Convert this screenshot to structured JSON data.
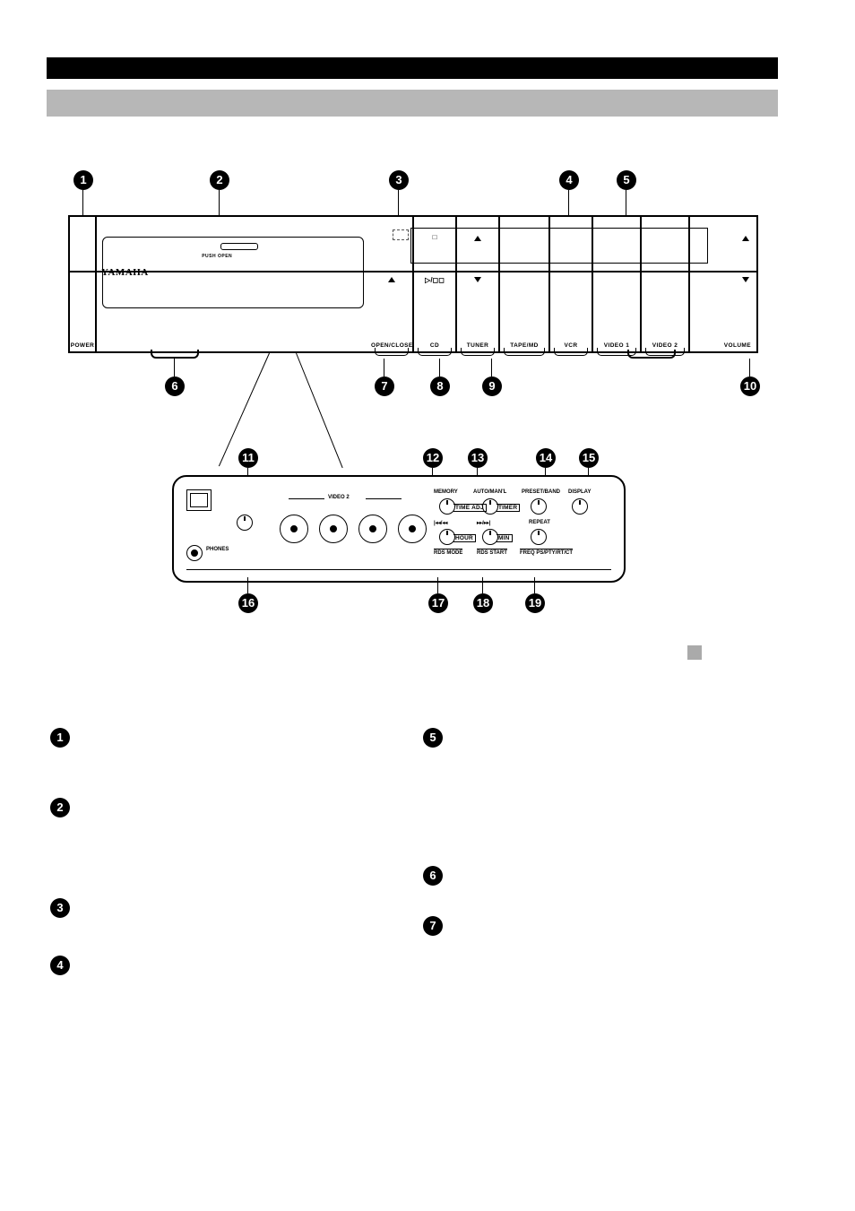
{
  "device": {
    "brand": "YAMAHA",
    "tray_sub": "PUSH OPEN",
    "buttons": {
      "power": "POWER",
      "open_close": "OPEN/CLOSE",
      "play_pause_label": "CD",
      "play_pause_glyph": "▷/◻◻",
      "stop_glyph": "□",
      "tuner": "TUNER",
      "tape_md": "TAPE/MD",
      "vcr": "VCR",
      "video1": "VIDEO 1",
      "video2": "VIDEO 2",
      "volume": "VOLUME"
    }
  },
  "detail": {
    "video2_label": "VIDEO 2",
    "phones_label": "PHONES",
    "row1": {
      "memory": "MEMORY",
      "time_adj": "TIME ADJ",
      "auto_manl": "AUTO/MAN'L",
      "timer": "TIMER",
      "preset_band": "PRESET/BAND",
      "display": "DISPLAY"
    },
    "row2": {
      "skip_back": "|◂◂/◂◂",
      "skip_fwd": "▸▸/▸▸|",
      "hour": "HOUR",
      "min": "MIN",
      "rds_mode": "RDS MODE",
      "rds_start": "RDS START",
      "repeat": "REPEAT",
      "freq": "FREQ PS/PTY/RT/CT"
    }
  },
  "callouts": {
    "upper": [
      "1",
      "2",
      "3",
      "4",
      "5",
      "6",
      "7",
      "8",
      "9",
      "10"
    ],
    "detail": [
      "11",
      "12",
      "13",
      "14",
      "15",
      "16",
      "17",
      "18",
      "19"
    ]
  }
}
